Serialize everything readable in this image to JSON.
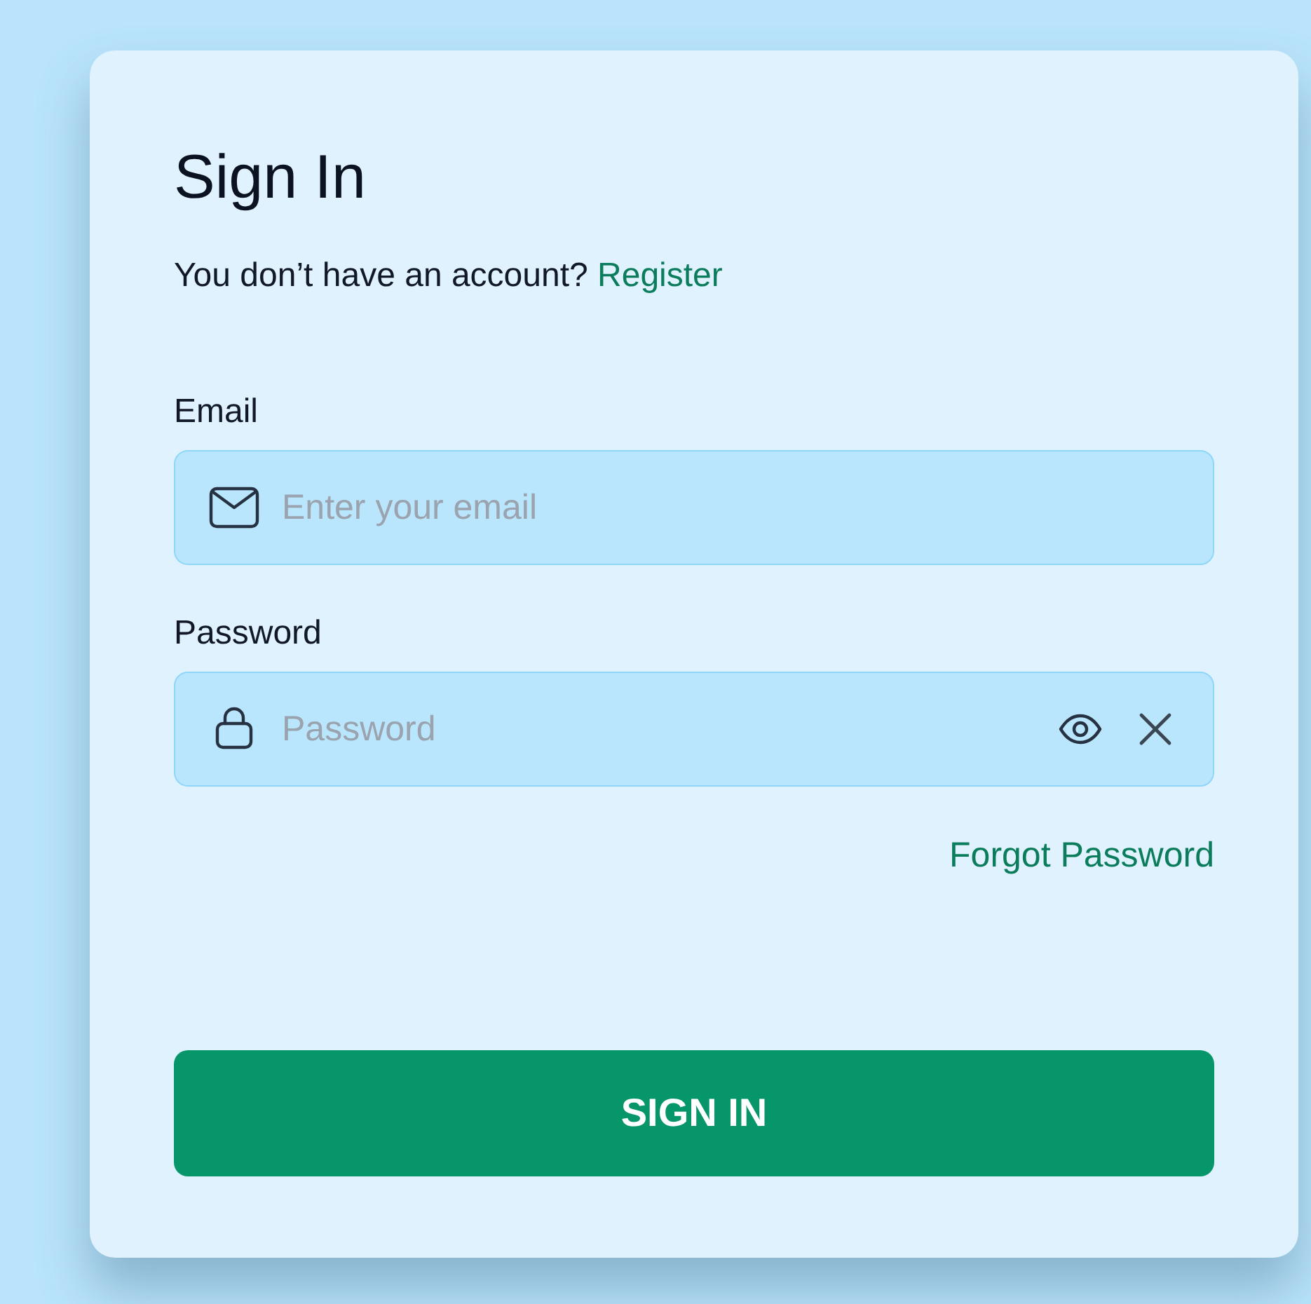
{
  "title": "Sign In",
  "prompt": {
    "text": "You don’t have an account?",
    "link": "Register"
  },
  "fields": [
    {
      "kind": "email",
      "label": "Email",
      "placeholder": "Enter your email"
    },
    {
      "kind": "password",
      "label": "Password",
      "placeholder": "Password"
    }
  ],
  "forgot_link": "Forgot Password",
  "submit_button": "SIGN IN"
}
